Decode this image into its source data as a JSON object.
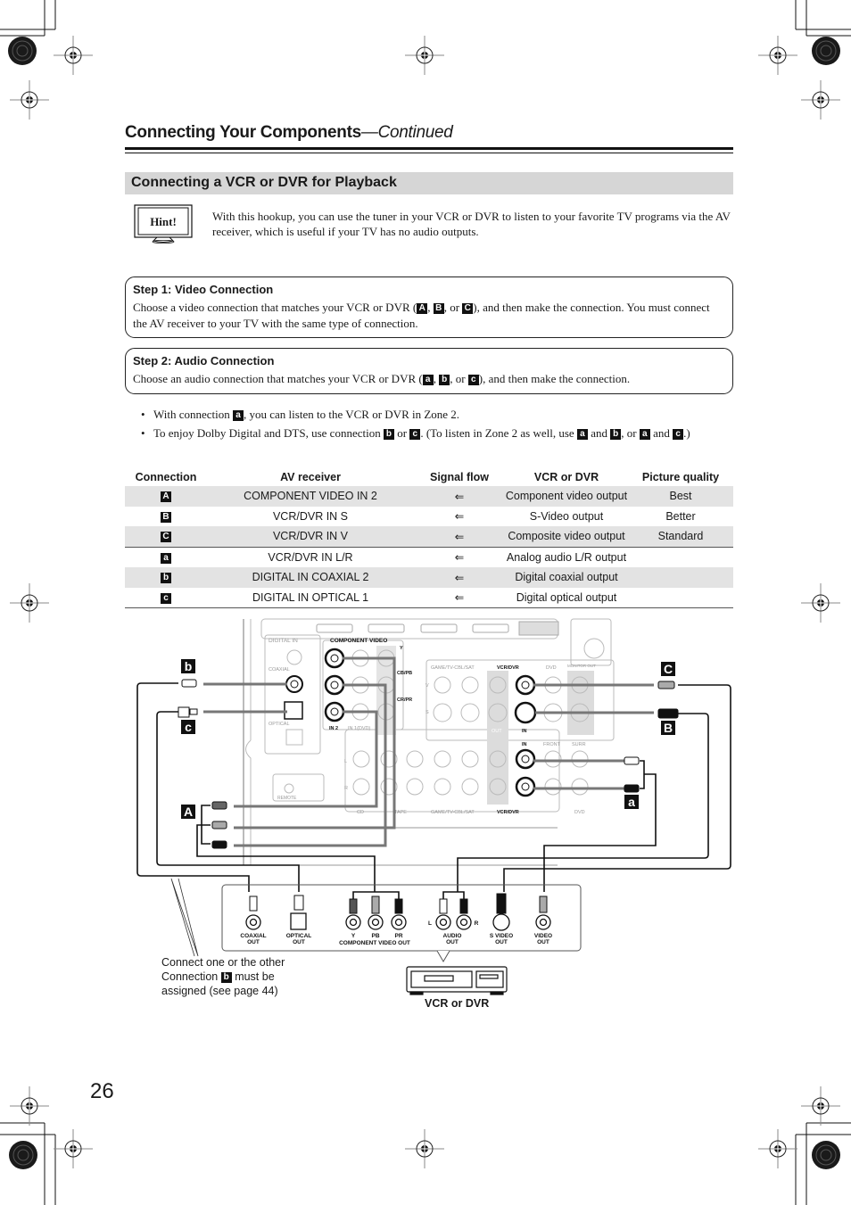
{
  "header": {
    "title": "Connecting Your Components",
    "continued": "—Continued"
  },
  "section": {
    "title": "Connecting a VCR or DVR for Playback"
  },
  "hint": {
    "label": "Hint!",
    "text": "With this hookup, you can use the tuner in your VCR or DVR to listen to your favorite TV programs via the AV receiver, which is useful if your TV has no audio outputs."
  },
  "step1": {
    "title": "Step 1: Video Connection",
    "text_before": "Choose a video connection that matches your VCR or DVR (",
    "badges": [
      "A",
      "B",
      "C"
    ],
    "sep1": ", ",
    "sep2": ", or ",
    "text_after": "), and then make the connection. You must connect the AV receiver to your TV with the same type of connection."
  },
  "step2": {
    "title": "Step 2: Audio Connection",
    "text_before": "Choose an audio connection that matches your VCR or DVR (",
    "badges": [
      "a",
      "b",
      "c"
    ],
    "sep1": ", ",
    "sep2": ", or ",
    "text_after": "), and then make the connection."
  },
  "bullets": {
    "b1_pre": "With connection ",
    "b1_badge": "a",
    "b1_post": ", you can listen to the VCR or DVR in Zone 2.",
    "b2_pre": "To enjoy Dolby Digital and DTS, use connection ",
    "b2_badge1": "b",
    "b2_mid1": " or ",
    "b2_badge2": "c",
    "b2_mid2": ". (To listen in Zone 2 as well, use ",
    "b2_badge3": "a",
    "b2_mid3": " and ",
    "b2_badge4": "b",
    "b2_mid4": ", or ",
    "b2_badge5": "a",
    "b2_mid5": " and ",
    "b2_badge6": "c",
    "b2_post": ".)"
  },
  "table": {
    "headers": [
      "Connection",
      "AV receiver",
      "Signal flow",
      "VCR or DVR",
      "Picture quality"
    ],
    "rows": [
      {
        "conn": "A",
        "receiver": "COMPONENT VIDEO IN 2",
        "flow": "⇐",
        "source": "Component video output",
        "quality": "Best"
      },
      {
        "conn": "B",
        "receiver": "VCR/DVR IN S",
        "flow": "⇐",
        "source": "S-Video output",
        "quality": "Better"
      },
      {
        "conn": "C",
        "receiver": "VCR/DVR IN V",
        "flow": "⇐",
        "source": "Composite video output",
        "quality": "Standard"
      },
      {
        "conn": "a",
        "receiver": "VCR/DVR IN L/R",
        "flow": "⇐",
        "source": "Analog audio L/R output",
        "quality": ""
      },
      {
        "conn": "b",
        "receiver": "DIGITAL IN COAXIAL 2",
        "flow": "⇐",
        "source": "Digital coaxial output",
        "quality": ""
      },
      {
        "conn": "c",
        "receiver": "DIGITAL IN OPTICAL 1",
        "flow": "⇐",
        "source": "Digital optical output",
        "quality": ""
      }
    ]
  },
  "diagram": {
    "receiver_labels": {
      "digital_in": "DIGITAL IN",
      "coaxial": "COAXIAL",
      "optical": "OPTICAL",
      "component_video": "COMPONENT VIDEO",
      "in2": "IN 2",
      "in1_dvd": "IN 1(DVD)",
      "y": "Y",
      "cb_pb": "CB/PB",
      "cr_pr": "CR/PR",
      "game_tv_cbl_sat": "GAME/TV-CBL/SAT",
      "vcr_dvr": "VCR/DVR",
      "dvd": "DVD",
      "monitor_out": "MONITOR OUT",
      "in": "IN",
      "out": "OUT",
      "front": "FRONT",
      "surr": "SURR",
      "cd": "CD",
      "tape": "TAPE",
      "remote": "REMOTE",
      "v": "V",
      "s": "S",
      "l": "L",
      "r": "R"
    },
    "callouts": {
      "b": "b",
      "c": "c",
      "A": "A",
      "C": "C",
      "B": "B",
      "a": "a"
    },
    "vcr_ports": {
      "coaxial_out": [
        "COAXIAL",
        "OUT"
      ],
      "optical_out": [
        "OPTICAL",
        "OUT"
      ],
      "y": "Y",
      "pb": "PB",
      "pr": "PR",
      "component_video_out": "COMPONENT VIDEO OUT",
      "l": "L",
      "r": "R",
      "audio_out": [
        "AUDIO",
        "OUT"
      ],
      "s_video_out": [
        "S VIDEO",
        "OUT"
      ],
      "video_out": [
        "VIDEO",
        "OUT"
      ]
    },
    "device_label": "VCR or DVR",
    "note_line1": "Connect one or the other",
    "note_line2_pre": "Connection ",
    "note_badge": "b",
    "note_line2_post": " must be",
    "note_line3": "assigned (see page 44)"
  },
  "page_number": "26"
}
